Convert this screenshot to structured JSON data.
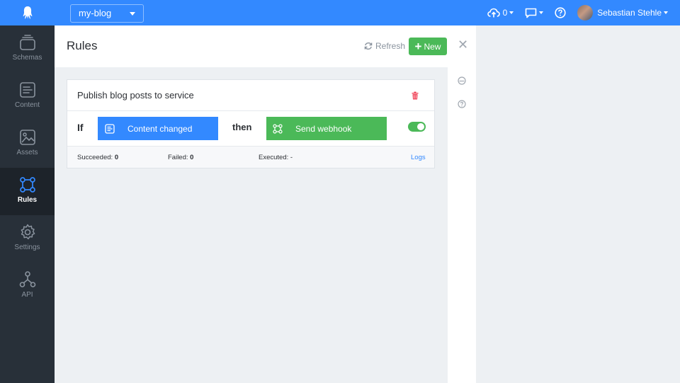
{
  "app": {
    "selected_app": "my-blog"
  },
  "header": {
    "upload_count": "0",
    "user_name": "Sebastian Stehle"
  },
  "sidebar": {
    "items": [
      {
        "label": "Schemas",
        "icon": "schemas-icon",
        "active": false
      },
      {
        "label": "Content",
        "icon": "content-icon",
        "active": false
      },
      {
        "label": "Assets",
        "icon": "assets-icon",
        "active": false
      },
      {
        "label": "Rules",
        "icon": "rules-icon",
        "active": true
      },
      {
        "label": "Settings",
        "icon": "settings-icon",
        "active": false
      },
      {
        "label": "API",
        "icon": "api-icon",
        "active": false
      }
    ]
  },
  "page": {
    "title": "Rules",
    "refresh_label": "Refresh",
    "new_label": "New"
  },
  "rule": {
    "name": "Publish blog posts to service",
    "if_label": "If",
    "trigger_label": "Content changed",
    "then_label": "then",
    "action_label": "Send webhook",
    "enabled": true,
    "succeeded_label": "Succeeded:",
    "succeeded_value": "0",
    "failed_label": "Failed:",
    "failed_value": "0",
    "executed_label": "Executed:",
    "executed_value": "-",
    "logs_label": "Logs"
  },
  "colors": {
    "primary": "#3389ff",
    "success": "#4bb958",
    "danger": "#f0475b",
    "sidebar": "#283039"
  }
}
